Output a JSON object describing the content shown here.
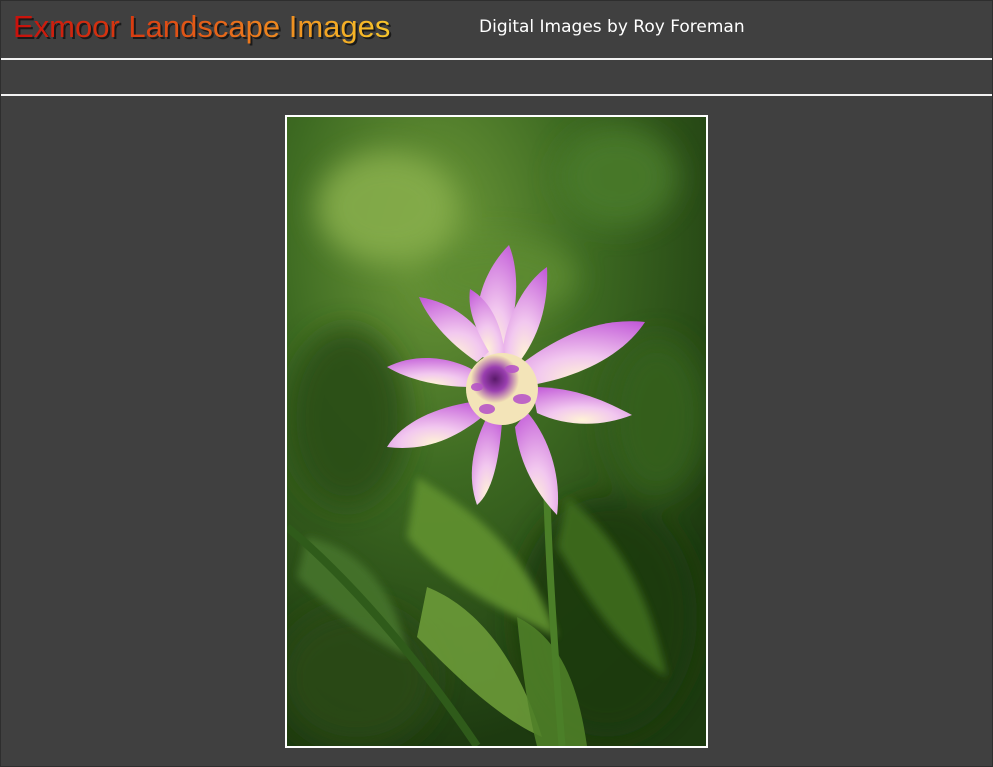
{
  "header": {
    "site_title": "Exmoor Landscape Images",
    "subtitle": "Digital Images by Roy Foreman"
  },
  "colors": {
    "background": "#404040",
    "title_gradient_start": "#c8100c",
    "title_gradient_end": "#f8c62a",
    "rule": "#f2f2f2",
    "photo_border": "#ffffff"
  },
  "photo": {
    "subject": "flower-photo",
    "icon": "photo-image"
  }
}
